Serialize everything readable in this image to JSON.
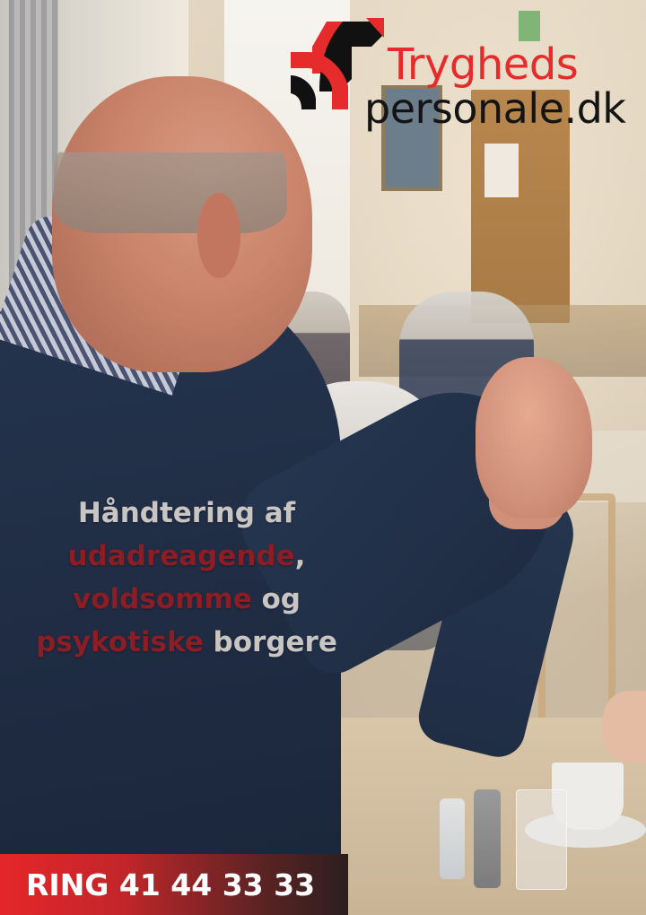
{
  "logo": {
    "brand_line1": "Trygheds",
    "brand_line2": "personale.dk"
  },
  "headline": {
    "line1": {
      "text": "Håndtering af"
    },
    "line2": {
      "accent": "udadreagende",
      "neutral": ","
    },
    "line3": {
      "accent": "voldsomme",
      "neutral": " og"
    },
    "line4": {
      "accent": "psykotiske",
      "neutral": " borgere"
    }
  },
  "cta": {
    "label": "RING 41 44 33 33"
  },
  "colors": {
    "brand_red": "#e52b2b",
    "accent_dark_red": "#8b1d24",
    "headline_gray": "#c9c5c2",
    "sweater_navy": "#1f2c43"
  }
}
